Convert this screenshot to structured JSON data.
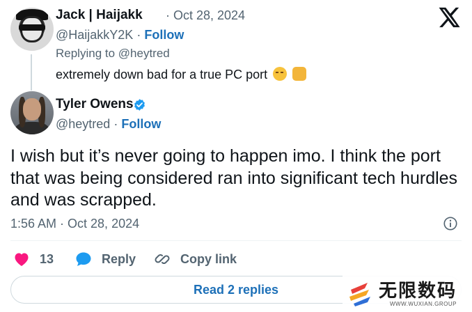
{
  "parent_tweet": {
    "name": "Jack | Haijakk",
    "separator_date": "· Oct 28, 2024",
    "handle": "@HaijakkY2K",
    "dot": "·",
    "follow_label": "Follow",
    "replying_prefix": "Replying to",
    "replying_mention": "@heytred",
    "text": "extremely down bad for a true PC port",
    "emojis": [
      "pensive-face",
      "oncoming-fist"
    ]
  },
  "main_tweet": {
    "name": "Tyler Owens",
    "verified": true,
    "handle": "@heytred",
    "dot": "·",
    "follow_label": "Follow",
    "text": "I wish but it’s never going to happen imo. I think the port that was being considered ran into significant tech hurdles and was scrapped.",
    "timestamp": "1:56 AM · Oct 28, 2024"
  },
  "actions": {
    "like_count": "13",
    "reply_label": "Reply",
    "copy_link_label": "Copy link"
  },
  "read_replies_label": "Read 2 replies",
  "watermark": {
    "title": "无限数码",
    "subtitle": "WWW.WUXIAN.GROUP"
  },
  "colors": {
    "link_blue": "#1d70b8",
    "muted_text": "#536471",
    "like_pink": "#f91880",
    "reply_blue": "#1d9bf0",
    "verified_blue": "#1d9bf0"
  },
  "icons": {
    "brand": "x-logo-icon",
    "verified": "verified-badge-icon",
    "info": "info-icon",
    "like": "heart-icon",
    "reply": "reply-bubble-icon",
    "copy_link": "link-icon"
  }
}
